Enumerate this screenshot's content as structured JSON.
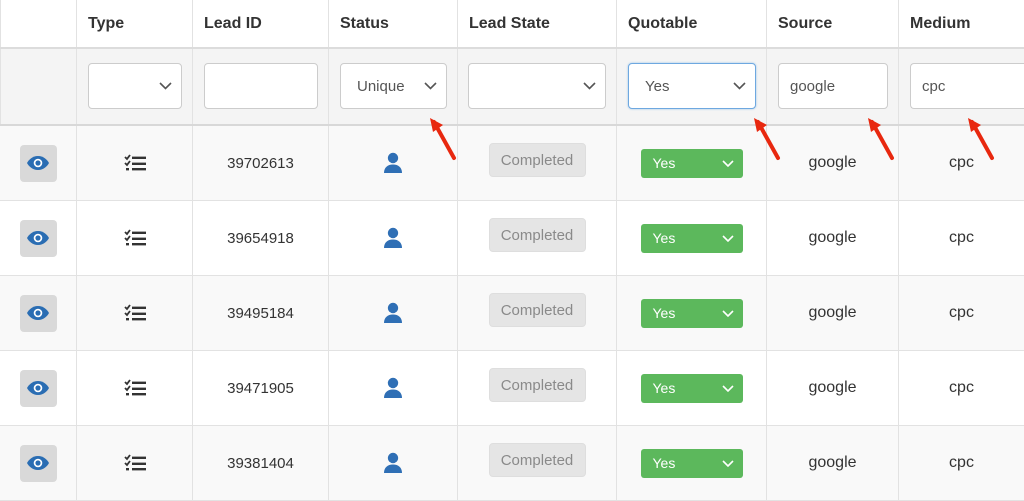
{
  "columns": [
    "",
    "Type",
    "Lead ID",
    "Status",
    "Lead State",
    "Quotable",
    "Source",
    "Medium"
  ],
  "filters": {
    "type": "",
    "lead_id": "",
    "status": "Unique",
    "lead_state": "",
    "quotable": "Yes",
    "source": "google",
    "medium": "cpc"
  },
  "rows": [
    {
      "lead_id": "39702613",
      "lead_state": "Completed",
      "quotable": "Yes",
      "source": "google",
      "medium": "cpc"
    },
    {
      "lead_id": "39654918",
      "lead_state": "Completed",
      "quotable": "Yes",
      "source": "google",
      "medium": "cpc"
    },
    {
      "lead_id": "39495184",
      "lead_state": "Completed",
      "quotable": "Yes",
      "source": "google",
      "medium": "cpc"
    },
    {
      "lead_id": "39471905",
      "lead_state": "Completed",
      "quotable": "Yes",
      "source": "google",
      "medium": "cpc"
    },
    {
      "lead_id": "39381404",
      "lead_state": "Completed",
      "quotable": "Yes",
      "source": "google",
      "medium": "cpc"
    }
  ],
  "icons": {
    "view": "eye-icon",
    "type": "checklist-icon",
    "status": "user-icon",
    "dropdown": "chevron-down-icon",
    "annotation": "red-arrow-icon"
  },
  "colors": {
    "eye": "#2a6db3",
    "user": "#2f6fb5",
    "quotable_green": "#5cb85c",
    "arrow_red": "#e8280f"
  }
}
